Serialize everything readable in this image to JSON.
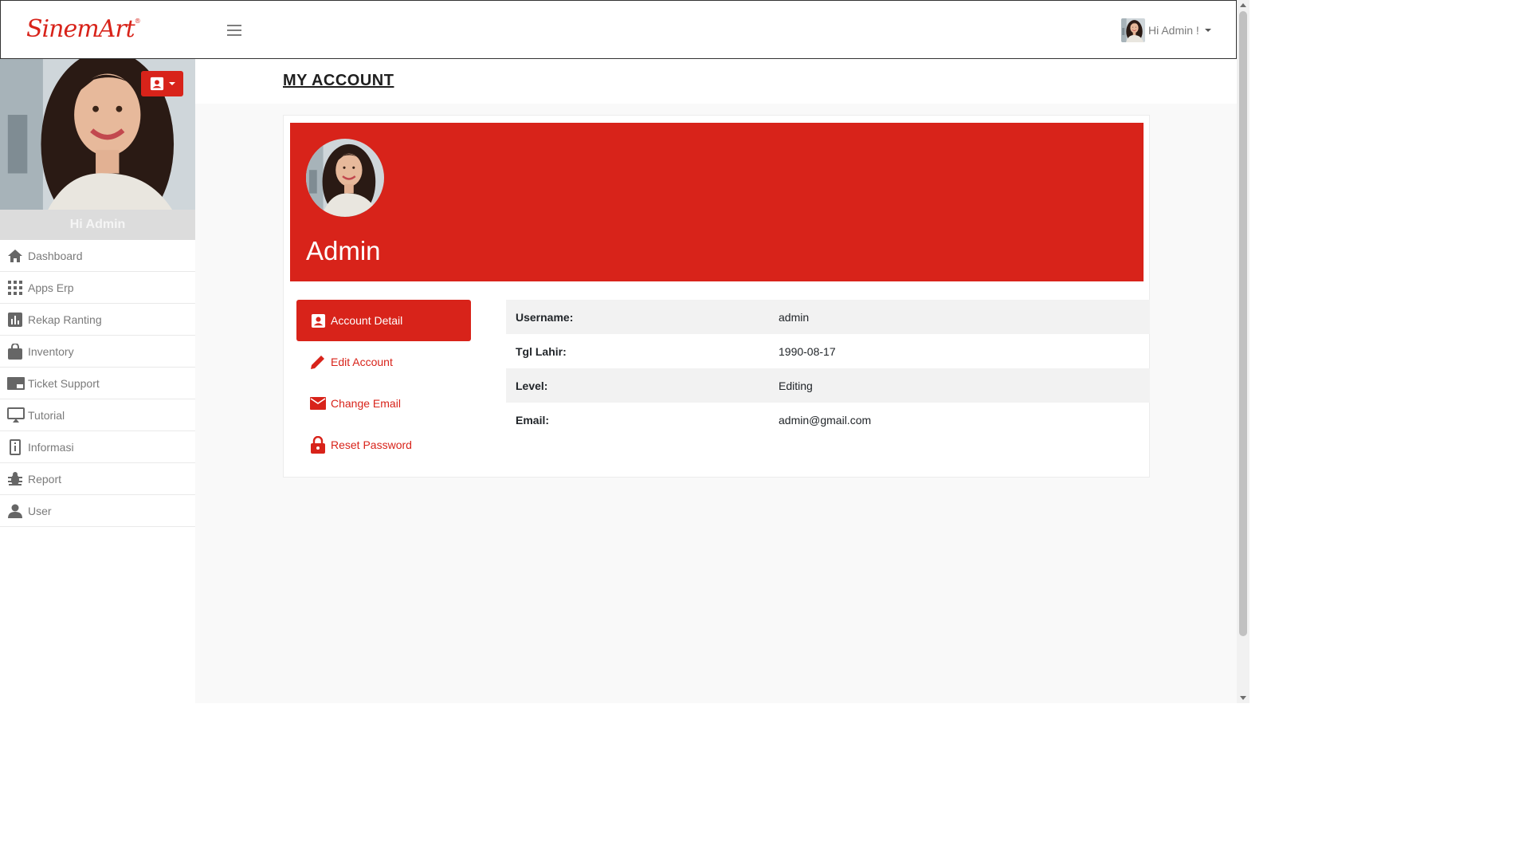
{
  "brand": {
    "logo_text": "SinemArt",
    "logo_mark": "®",
    "color": "#d8231a"
  },
  "topbar": {
    "user_greeting": "Hi Admin !",
    "menu_icon": "hamburger-icon"
  },
  "sidebar": {
    "greeting": "Hi Admin",
    "photo_button_icon": "contact-card-icon",
    "items": [
      {
        "label": "Dashboard",
        "icon": "home-icon"
      },
      {
        "label": "Apps Erp",
        "icon": "grid-icon"
      },
      {
        "label": "Rekap Ranting",
        "icon": "bar-chart-icon"
      },
      {
        "label": "Inventory",
        "icon": "shopping-bag-icon"
      },
      {
        "label": "Ticket Support",
        "icon": "ticket-icon"
      },
      {
        "label": "Tutorial",
        "icon": "monitor-icon"
      },
      {
        "label": "Informasi",
        "icon": "info-icon"
      },
      {
        "label": "Report",
        "icon": "bug-icon"
      },
      {
        "label": "User",
        "icon": "user-icon"
      }
    ]
  },
  "page": {
    "title": "MY ACCOUNT",
    "profile_name": "Admin",
    "tabs": [
      {
        "label": "Account Detail",
        "icon": "contact-card-icon",
        "active": true
      },
      {
        "label": "Edit Account",
        "icon": "pencil-icon",
        "active": false
      },
      {
        "label": "Change Email",
        "icon": "envelope-icon",
        "active": false
      },
      {
        "label": "Reset Password",
        "icon": "lock-icon",
        "active": false
      }
    ],
    "details": [
      {
        "key": "Username:",
        "value": "admin"
      },
      {
        "key": "Tgl Lahir:",
        "value": "1990-08-17"
      },
      {
        "key": "Level:",
        "value": "Editing"
      },
      {
        "key": "Email:",
        "value": "admin@gmail.com"
      }
    ]
  }
}
